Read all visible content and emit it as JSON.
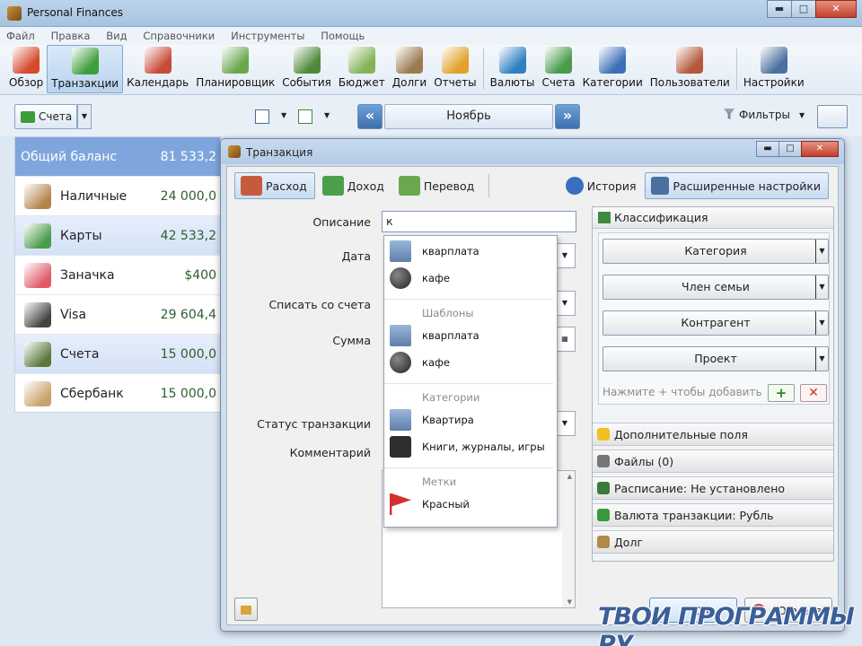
{
  "window": {
    "title": "Personal Finances",
    "btn_min": "▬",
    "btn_max": "□",
    "btn_close": "✕"
  },
  "menu": [
    "Файл",
    "Правка",
    "Вид",
    "Справочники",
    "Инструменты",
    "Помощь"
  ],
  "toolbar": [
    {
      "label": "Обзор",
      "icon": "calendar-icon",
      "color": "#d64a2e"
    },
    {
      "label": "Транзакции",
      "icon": "book-icon",
      "color": "#3f9e3a",
      "active": true
    },
    {
      "label": "Календарь",
      "icon": "calendar-grid-icon",
      "color": "#c94c3a"
    },
    {
      "label": "Планировщик",
      "icon": "compass-icon",
      "color": "#6aa84f"
    },
    {
      "label": "События",
      "icon": "checklist-icon",
      "color": "#4f8a3a"
    },
    {
      "label": "Бюджет",
      "icon": "envelope-money-icon",
      "color": "#86b35a"
    },
    {
      "label": "Долги",
      "icon": "money-hand-icon",
      "color": "#9a7b4f"
    },
    {
      "label": "Отчеты",
      "icon": "pie-chart-icon",
      "color": "#e2a12b"
    },
    {
      "label": "Валюты",
      "icon": "currency-icon",
      "color": "#2f7fc1"
    },
    {
      "label": "Счета",
      "icon": "banknotes-icon",
      "color": "#4a9b4a"
    },
    {
      "label": "Категории",
      "icon": "hierarchy-icon",
      "color": "#3d6fb8"
    },
    {
      "label": "Пользователи",
      "icon": "users-icon",
      "color": "#b5573a"
    },
    {
      "label": "Настройки",
      "icon": "settings-icon",
      "color": "#4a6fa0"
    }
  ],
  "row2": {
    "accounts_label": "Счета",
    "month": "Ноябрь",
    "prev": "«",
    "next": "»",
    "filters": "Фильтры"
  },
  "accounts": [
    {
      "name": "Общий баланс",
      "value": "81 533,2",
      "kind": "total"
    },
    {
      "name": "Наличные",
      "value": "24 000,0",
      "kind": "item",
      "icon": "wallet-icon",
      "color": "#b5844a"
    },
    {
      "name": "Карты",
      "value": "42 533,2",
      "kind": "group",
      "icon": "cards-icon",
      "color": "#4a9b4a"
    },
    {
      "name": "Заначка",
      "value": "$400",
      "kind": "item",
      "icon": "piggy-bank-icon",
      "color": "#e05a6a"
    },
    {
      "name": "Visa",
      "value": "29 604,4",
      "kind": "item",
      "icon": "credit-card-icon",
      "color": "#444"
    },
    {
      "name": "Счета",
      "value": "15 000,0",
      "kind": "group",
      "icon": "account-book-icon",
      "color": "#5a7a3a"
    },
    {
      "name": "Сбербанк",
      "value": "15 000,0",
      "kind": "item",
      "icon": "bank-safe-icon",
      "color": "#c9a36a"
    }
  ],
  "dialog": {
    "title": "Транзакция",
    "tabs": {
      "expense": "Расход",
      "income": "Доход",
      "transfer": "Перевод"
    },
    "history": "История",
    "advanced": "Расширенные настройки",
    "labels": {
      "description": "Описание",
      "date": "Дата",
      "from_account": "Списать со счета",
      "amount": "Сумма",
      "status": "Статус транзакции",
      "comment": "Комментарий"
    },
    "description_value": "к",
    "dropdown": {
      "recent": [
        {
          "text": "кварплата",
          "icon": "building-icon"
        },
        {
          "text": "кафе",
          "icon": "ball-icon"
        }
      ],
      "templates_header": "Шаблоны",
      "templates": [
        {
          "text": "кварплата",
          "icon": "building-icon"
        },
        {
          "text": "кафе",
          "icon": "ball-icon"
        }
      ],
      "categories_header": "Категории",
      "categories": [
        {
          "text": "Квартира",
          "icon": "building-icon"
        },
        {
          "text": "Книги, журналы, игры",
          "icon": "device-icon"
        }
      ],
      "tags_header": "Метки",
      "tags": [
        {
          "text": "Красный",
          "icon": "red-flag-icon"
        }
      ]
    },
    "classification": {
      "header": "Классификация",
      "selects": [
        "Категория",
        "Член семьи",
        "Контрагент",
        "Проект"
      ],
      "hint": "Нажмите + чтобы добавить",
      "plus": "+",
      "minus": "✕"
    },
    "sections": [
      {
        "label": "Дополнительные поля",
        "icon": "star-icon",
        "color": "#f0c020"
      },
      {
        "label": "Файлы (0)",
        "icon": "paperclip-icon",
        "color": "#777"
      },
      {
        "label": "Расписание: Не установлено",
        "icon": "clock-icon",
        "color": "#3a7a3a"
      },
      {
        "label": "Валюта транзакции: Рубль",
        "icon": "dollar-icon",
        "color": "#3a9a3a"
      },
      {
        "label": "Долг",
        "icon": "money-icon",
        "color": "#b08a4a"
      }
    ],
    "ok": "ОК",
    "cancel": "Отмена"
  },
  "watermark": "ТВОИ ПРОГРАММЫ РУ"
}
